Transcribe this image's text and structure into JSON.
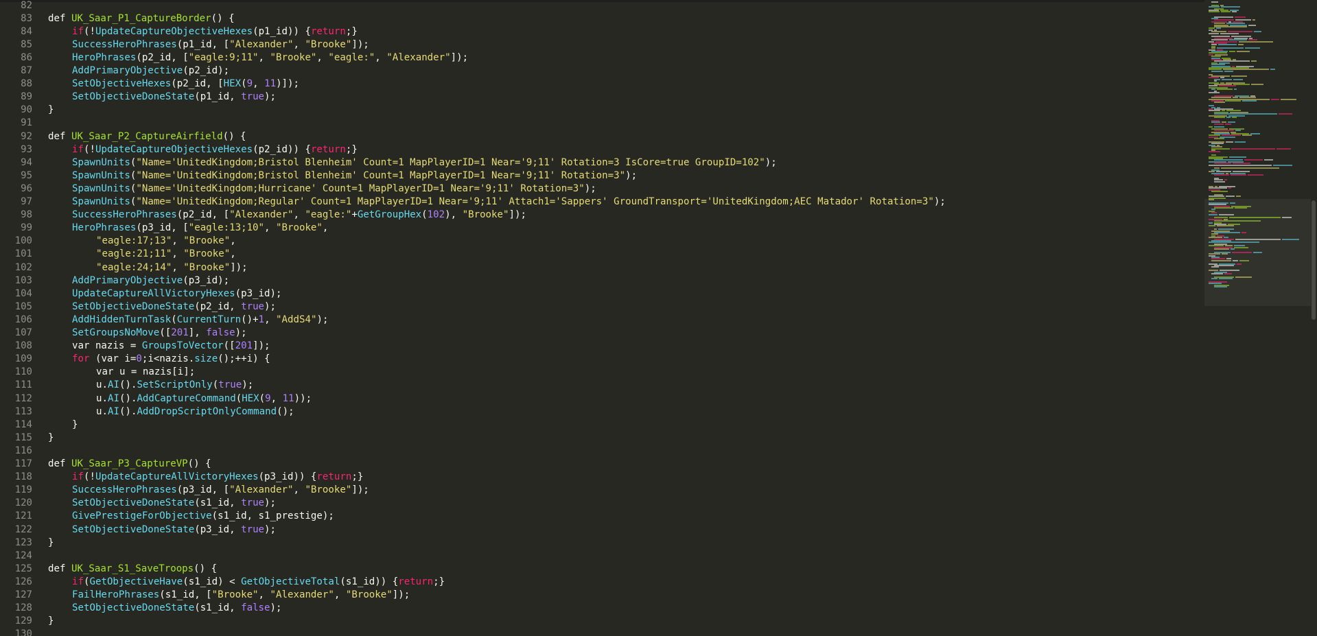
{
  "colors": {
    "background": "#272822",
    "keyword": "#f92672",
    "function_name": "#a6e22e",
    "builtin_call": "#66d9ef",
    "string": "#e6db74",
    "number": "#ae81ff",
    "text": "#f8f8f2",
    "line_number": "#8f908a"
  },
  "lines": [
    {
      "n": "82",
      "indent": 0,
      "tokens": []
    },
    {
      "n": "83",
      "indent": 0,
      "tokens": [
        [
          "def",
          "def"
        ],
        [
          "txt",
          " "
        ],
        [
          "fn",
          "UK_Saar_P1_CaptureBorder"
        ],
        [
          "txt",
          "() {"
        ]
      ]
    },
    {
      "n": "84",
      "indent": 1,
      "tokens": [
        [
          "kw",
          "if"
        ],
        [
          "txt",
          "(!"
        ],
        [
          "call",
          "UpdateCaptureObjectiveHexes"
        ],
        [
          "txt",
          "(p1_id)) {"
        ],
        [
          "kw",
          "return"
        ],
        [
          "txt",
          ";}"
        ]
      ]
    },
    {
      "n": "85",
      "indent": 1,
      "tokens": [
        [
          "call",
          "SuccessHeroPhrases"
        ],
        [
          "txt",
          "(p1_id, ["
        ],
        [
          "str",
          "\"Alexander\""
        ],
        [
          "txt",
          ", "
        ],
        [
          "str",
          "\"Brooke\""
        ],
        [
          "txt",
          "]);"
        ]
      ]
    },
    {
      "n": "86",
      "indent": 1,
      "tokens": [
        [
          "call",
          "HeroPhrases"
        ],
        [
          "txt",
          "(p2_id, ["
        ],
        [
          "str",
          "\"eagle:9;11\""
        ],
        [
          "txt",
          ", "
        ],
        [
          "str",
          "\"Brooke\""
        ],
        [
          "txt",
          ", "
        ],
        [
          "str",
          "\"eagle:\""
        ],
        [
          "txt",
          ", "
        ],
        [
          "str",
          "\"Alexander\""
        ],
        [
          "txt",
          "]);"
        ]
      ]
    },
    {
      "n": "87",
      "indent": 1,
      "tokens": [
        [
          "call",
          "AddPrimaryObjective"
        ],
        [
          "txt",
          "(p2_id);"
        ]
      ]
    },
    {
      "n": "88",
      "indent": 1,
      "tokens": [
        [
          "call",
          "SetObjectiveHexes"
        ],
        [
          "txt",
          "(p2_id, ["
        ],
        [
          "call",
          "HEX"
        ],
        [
          "txt",
          "("
        ],
        [
          "num",
          "9"
        ],
        [
          "txt",
          ", "
        ],
        [
          "num",
          "11"
        ],
        [
          "txt",
          ")]);"
        ]
      ]
    },
    {
      "n": "89",
      "indent": 1,
      "tokens": [
        [
          "call",
          "SetObjectiveDoneState"
        ],
        [
          "txt",
          "(p1_id, "
        ],
        [
          "num",
          "true"
        ],
        [
          "txt",
          ");"
        ]
      ]
    },
    {
      "n": "90",
      "indent": 0,
      "tokens": [
        [
          "txt",
          "}"
        ]
      ]
    },
    {
      "n": "91",
      "indent": 0,
      "tokens": []
    },
    {
      "n": "92",
      "indent": 0,
      "tokens": [
        [
          "def",
          "def"
        ],
        [
          "txt",
          " "
        ],
        [
          "fn",
          "UK_Saar_P2_CaptureAirfield"
        ],
        [
          "txt",
          "() {"
        ]
      ]
    },
    {
      "n": "93",
      "indent": 1,
      "tokens": [
        [
          "kw",
          "if"
        ],
        [
          "txt",
          "(!"
        ],
        [
          "call",
          "UpdateCaptureObjectiveHexes"
        ],
        [
          "txt",
          "(p2_id)) {"
        ],
        [
          "kw",
          "return"
        ],
        [
          "txt",
          ";}"
        ]
      ]
    },
    {
      "n": "94",
      "indent": 1,
      "tokens": [
        [
          "call",
          "SpawnUnits"
        ],
        [
          "txt",
          "("
        ],
        [
          "str",
          "\"Name='UnitedKingdom;Bristol Blenheim' Count=1 MapPlayerID=1 Near='9;11' Rotation=3 IsCore=true GroupID=102\""
        ],
        [
          "txt",
          ");"
        ]
      ]
    },
    {
      "n": "95",
      "indent": 1,
      "tokens": [
        [
          "call",
          "SpawnUnits"
        ],
        [
          "txt",
          "("
        ],
        [
          "str",
          "\"Name='UnitedKingdom;Bristol Blenheim' Count=1 MapPlayerID=1 Near='9;11' Rotation=3\""
        ],
        [
          "txt",
          ");"
        ]
      ]
    },
    {
      "n": "96",
      "indent": 1,
      "tokens": [
        [
          "call",
          "SpawnUnits"
        ],
        [
          "txt",
          "("
        ],
        [
          "str",
          "\"Name='UnitedKingdom;Hurricane' Count=1 MapPlayerID=1 Near='9;11' Rotation=3\""
        ],
        [
          "txt",
          ");"
        ]
      ]
    },
    {
      "n": "97",
      "indent": 1,
      "tokens": [
        [
          "call",
          "SpawnUnits"
        ],
        [
          "txt",
          "("
        ],
        [
          "str",
          "\"Name='UnitedKingdom;Regular' Count=1 MapPlayerID=1 Near='9;11' Attach1='Sappers' GroundTransport='UnitedKingdom;AEC Matador' Rotation=3\""
        ],
        [
          "txt",
          ");"
        ]
      ]
    },
    {
      "n": "98",
      "indent": 1,
      "tokens": [
        [
          "call",
          "SuccessHeroPhrases"
        ],
        [
          "txt",
          "(p2_id, ["
        ],
        [
          "str",
          "\"Alexander\""
        ],
        [
          "txt",
          ", "
        ],
        [
          "str",
          "\"eagle:\""
        ],
        [
          "txt",
          "+"
        ],
        [
          "call",
          "GetGroupHex"
        ],
        [
          "txt",
          "("
        ],
        [
          "num",
          "102"
        ],
        [
          "txt",
          "), "
        ],
        [
          "str",
          "\"Brooke\""
        ],
        [
          "txt",
          "]);"
        ]
      ]
    },
    {
      "n": "99",
      "indent": 1,
      "tokens": [
        [
          "call",
          "HeroPhrases"
        ],
        [
          "txt",
          "(p3_id, ["
        ],
        [
          "str",
          "\"eagle:13;10\""
        ],
        [
          "txt",
          ", "
        ],
        [
          "str",
          "\"Brooke\""
        ],
        [
          "txt",
          ","
        ]
      ]
    },
    {
      "n": "100",
      "indent": 2,
      "tokens": [
        [
          "str",
          "\"eagle:17;13\""
        ],
        [
          "txt",
          ", "
        ],
        [
          "str",
          "\"Brooke\""
        ],
        [
          "txt",
          ","
        ]
      ]
    },
    {
      "n": "101",
      "indent": 2,
      "tokens": [
        [
          "str",
          "\"eagle:21;11\""
        ],
        [
          "txt",
          ", "
        ],
        [
          "str",
          "\"Brooke\""
        ],
        [
          "txt",
          ","
        ]
      ]
    },
    {
      "n": "102",
      "indent": 2,
      "tokens": [
        [
          "str",
          "\"eagle:24;14\""
        ],
        [
          "txt",
          ", "
        ],
        [
          "str",
          "\"Brooke\""
        ],
        [
          "txt",
          "]);"
        ]
      ]
    },
    {
      "n": "103",
      "indent": 1,
      "tokens": [
        [
          "call",
          "AddPrimaryObjective"
        ],
        [
          "txt",
          "(p3_id);"
        ]
      ]
    },
    {
      "n": "104",
      "indent": 1,
      "tokens": [
        [
          "call",
          "UpdateCaptureAllVictoryHexes"
        ],
        [
          "txt",
          "(p3_id);"
        ]
      ]
    },
    {
      "n": "105",
      "indent": 1,
      "tokens": [
        [
          "call",
          "SetObjectiveDoneState"
        ],
        [
          "txt",
          "(p2_id, "
        ],
        [
          "num",
          "true"
        ],
        [
          "txt",
          ");"
        ]
      ]
    },
    {
      "n": "106",
      "indent": 1,
      "tokens": [
        [
          "call",
          "AddHiddenTurnTask"
        ],
        [
          "txt",
          "("
        ],
        [
          "call",
          "CurrentTurn"
        ],
        [
          "txt",
          "()+"
        ],
        [
          "num",
          "1"
        ],
        [
          "txt",
          ", "
        ],
        [
          "str",
          "\"AddS4\""
        ],
        [
          "txt",
          ");"
        ]
      ]
    },
    {
      "n": "107",
      "indent": 1,
      "tokens": [
        [
          "call",
          "SetGroupsNoMove"
        ],
        [
          "txt",
          "(["
        ],
        [
          "num",
          "201"
        ],
        [
          "txt",
          "], "
        ],
        [
          "num",
          "false"
        ],
        [
          "txt",
          ");"
        ]
      ]
    },
    {
      "n": "108",
      "indent": 1,
      "tokens": [
        [
          "txt",
          "var nazis = "
        ],
        [
          "call",
          "GroupsToVector"
        ],
        [
          "txt",
          "(["
        ],
        [
          "num",
          "201"
        ],
        [
          "txt",
          "]);"
        ]
      ]
    },
    {
      "n": "109",
      "indent": 1,
      "tokens": [
        [
          "kw",
          "for"
        ],
        [
          "txt",
          " (var i="
        ],
        [
          "num",
          "0"
        ],
        [
          "txt",
          ";i<nazis."
        ],
        [
          "call",
          "size"
        ],
        [
          "txt",
          "();++i) {"
        ]
      ]
    },
    {
      "n": "110",
      "indent": 2,
      "tokens": [
        [
          "txt",
          "var u = nazis[i];"
        ]
      ]
    },
    {
      "n": "111",
      "indent": 2,
      "tokens": [
        [
          "txt",
          "u."
        ],
        [
          "call",
          "AI"
        ],
        [
          "txt",
          "()."
        ],
        [
          "call",
          "SetScriptOnly"
        ],
        [
          "txt",
          "("
        ],
        [
          "num",
          "true"
        ],
        [
          "txt",
          ");"
        ]
      ]
    },
    {
      "n": "112",
      "indent": 2,
      "tokens": [
        [
          "txt",
          "u."
        ],
        [
          "call",
          "AI"
        ],
        [
          "txt",
          "()."
        ],
        [
          "call",
          "AddCaptureCommand"
        ],
        [
          "txt",
          "("
        ],
        [
          "call",
          "HEX"
        ],
        [
          "txt",
          "("
        ],
        [
          "num",
          "9"
        ],
        [
          "txt",
          ", "
        ],
        [
          "num",
          "11"
        ],
        [
          "txt",
          "));"
        ]
      ]
    },
    {
      "n": "113",
      "indent": 2,
      "tokens": [
        [
          "txt",
          "u."
        ],
        [
          "call",
          "AI"
        ],
        [
          "txt",
          "()."
        ],
        [
          "call",
          "AddDropScriptOnlyCommand"
        ],
        [
          "txt",
          "();"
        ]
      ]
    },
    {
      "n": "114",
      "indent": 1,
      "tokens": [
        [
          "txt",
          "}"
        ]
      ]
    },
    {
      "n": "115",
      "indent": 0,
      "tokens": [
        [
          "txt",
          "}"
        ]
      ]
    },
    {
      "n": "116",
      "indent": 0,
      "tokens": []
    },
    {
      "n": "117",
      "indent": 0,
      "tokens": [
        [
          "def",
          "def"
        ],
        [
          "txt",
          " "
        ],
        [
          "fn",
          "UK_Saar_P3_CaptureVP"
        ],
        [
          "txt",
          "() {"
        ]
      ]
    },
    {
      "n": "118",
      "indent": 1,
      "tokens": [
        [
          "kw",
          "if"
        ],
        [
          "txt",
          "(!"
        ],
        [
          "call",
          "UpdateCaptureAllVictoryHexes"
        ],
        [
          "txt",
          "(p3_id)) {"
        ],
        [
          "kw",
          "return"
        ],
        [
          "txt",
          ";}"
        ]
      ]
    },
    {
      "n": "119",
      "indent": 1,
      "tokens": [
        [
          "call",
          "SuccessHeroPhrases"
        ],
        [
          "txt",
          "(p3_id, ["
        ],
        [
          "str",
          "\"Alexander\""
        ],
        [
          "txt",
          ", "
        ],
        [
          "str",
          "\"Brooke\""
        ],
        [
          "txt",
          "]);"
        ]
      ]
    },
    {
      "n": "120",
      "indent": 1,
      "tokens": [
        [
          "call",
          "SetObjectiveDoneState"
        ],
        [
          "txt",
          "(s1_id, "
        ],
        [
          "num",
          "true"
        ],
        [
          "txt",
          ");"
        ]
      ]
    },
    {
      "n": "121",
      "indent": 1,
      "tokens": [
        [
          "call",
          "GivePrestigeForObjective"
        ],
        [
          "txt",
          "(s1_id, s1_prestige);"
        ]
      ]
    },
    {
      "n": "122",
      "indent": 1,
      "tokens": [
        [
          "call",
          "SetObjectiveDoneState"
        ],
        [
          "txt",
          "(p3_id, "
        ],
        [
          "num",
          "true"
        ],
        [
          "txt",
          ");"
        ]
      ]
    },
    {
      "n": "123",
      "indent": 0,
      "tokens": [
        [
          "txt",
          "}"
        ]
      ]
    },
    {
      "n": "124",
      "indent": 0,
      "tokens": []
    },
    {
      "n": "125",
      "indent": 0,
      "tokens": [
        [
          "def",
          "def"
        ],
        [
          "txt",
          " "
        ],
        [
          "fn",
          "UK_Saar_S1_SaveTroops"
        ],
        [
          "txt",
          "() {"
        ]
      ]
    },
    {
      "n": "126",
      "indent": 1,
      "tokens": [
        [
          "kw",
          "if"
        ],
        [
          "txt",
          "("
        ],
        [
          "call",
          "GetObjectiveHave"
        ],
        [
          "txt",
          "(s1_id) < "
        ],
        [
          "call",
          "GetObjectiveTotal"
        ],
        [
          "txt",
          "(s1_id)) {"
        ],
        [
          "kw",
          "return"
        ],
        [
          "txt",
          ";}"
        ]
      ]
    },
    {
      "n": "127",
      "indent": 1,
      "tokens": [
        [
          "call",
          "FailHeroPhrases"
        ],
        [
          "txt",
          "(s1_id, ["
        ],
        [
          "str",
          "\"Brooke\""
        ],
        [
          "txt",
          ", "
        ],
        [
          "str",
          "\"Alexander\""
        ],
        [
          "txt",
          ", "
        ],
        [
          "str",
          "\"Brooke\""
        ],
        [
          "txt",
          "]);"
        ]
      ]
    },
    {
      "n": "128",
      "indent": 1,
      "tokens": [
        [
          "call",
          "SetObjectiveDoneState"
        ],
        [
          "txt",
          "(s1_id, "
        ],
        [
          "num",
          "false"
        ],
        [
          "txt",
          ");"
        ]
      ]
    },
    {
      "n": "129",
      "indent": 0,
      "tokens": [
        [
          "txt",
          "}"
        ]
      ]
    },
    {
      "n": "130",
      "indent": 0,
      "tokens": []
    }
  ]
}
